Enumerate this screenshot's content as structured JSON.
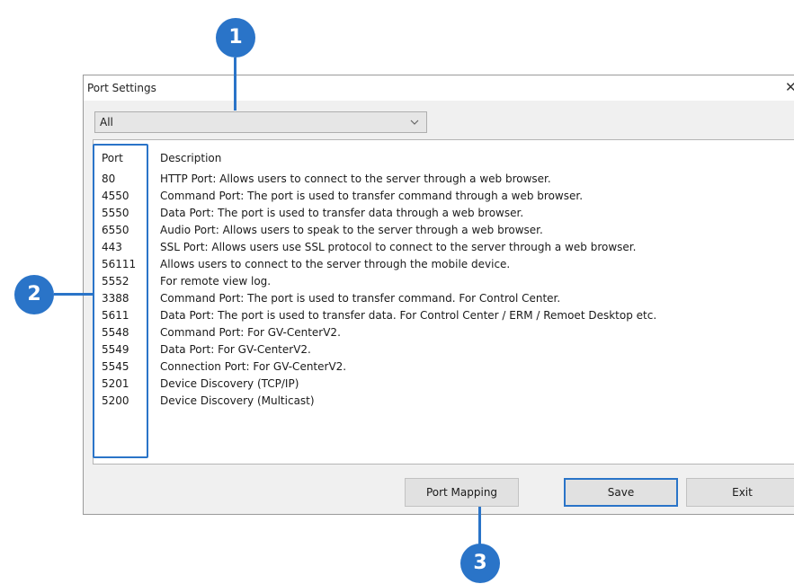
{
  "window": {
    "title": "Port Settings",
    "close_symbol": "✕"
  },
  "filter": {
    "selected": "All"
  },
  "table": {
    "headers": [
      "Port",
      "Description"
    ],
    "rows": [
      [
        "80",
        "HTTP Port: Allows users to connect to the server through a web browser."
      ],
      [
        "4550",
        "Command Port: The port is used to transfer command through a web browser."
      ],
      [
        "5550",
        "Data Port: The port is used to transfer data through a web browser."
      ],
      [
        "6550",
        "Audio Port: Allows users to speak to the server through a web browser."
      ],
      [
        "443",
        "SSL Port: Allows users use SSL protocol to connect to the server through a web browser."
      ],
      [
        "56111",
        "Allows users to connect to the server through the mobile device."
      ],
      [
        "5552",
        "For remote view log."
      ],
      [
        "3388",
        "Command Port: The port is used to transfer command. For Control Center."
      ],
      [
        "5611",
        "Data Port: The port is used to transfer data. For Control Center / ERM / Remoet Desktop etc."
      ],
      [
        "5548",
        "Command Port: For GV-CenterV2."
      ],
      [
        "5549",
        "Data Port: For GV-CenterV2."
      ],
      [
        "5545",
        "Connection Port: For GV-CenterV2."
      ],
      [
        "5201",
        "Device Discovery (TCP/IP)"
      ],
      [
        "5200",
        "Device Discovery (Multicast)"
      ]
    ]
  },
  "buttons": {
    "port_mapping": "Port Mapping",
    "save": "Save",
    "exit": "Exit"
  },
  "callouts": [
    "1",
    "2",
    "3"
  ],
  "colors": {
    "accent": "#2a74c8"
  }
}
